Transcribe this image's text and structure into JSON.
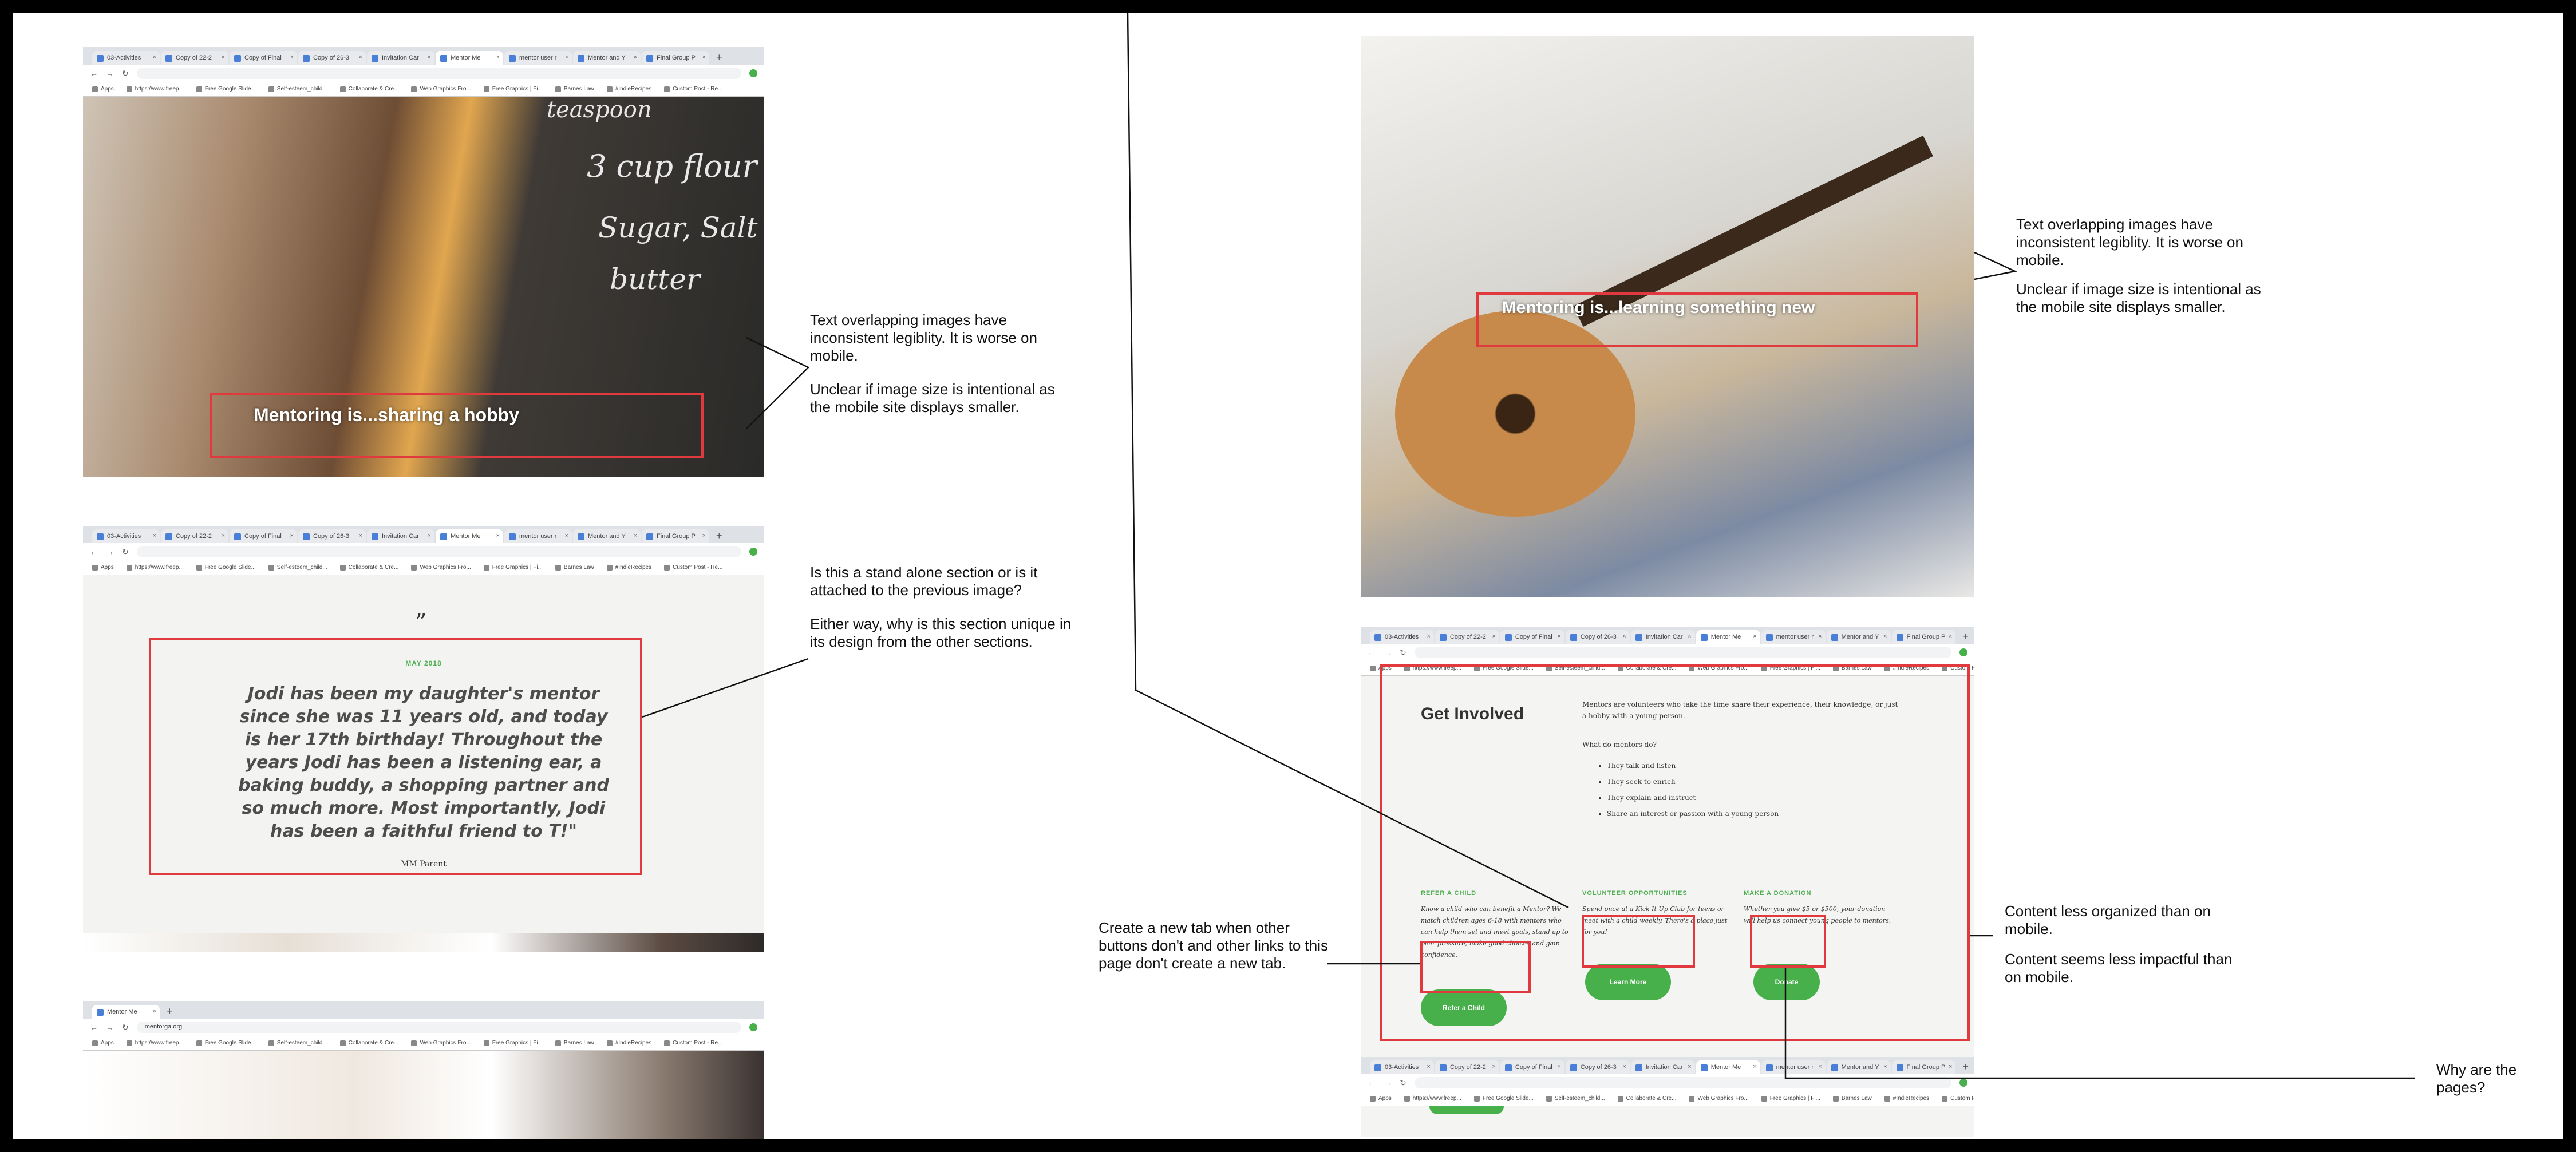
{
  "browser": {
    "tabs": [
      "03-Activities",
      "Copy of 22-2",
      "Copy of Final",
      "Copy of 26-3",
      "Invitation Car",
      "Mentor Me",
      "mentor user r",
      "Mentor and Y",
      "Final Group P"
    ],
    "new_tab_glyph": "+",
    "close_glyph": "×",
    "address": "mentorga.org",
    "bookmarks": [
      "Apps",
      "https://www.freep...",
      "Free Google Slide...",
      "Self-esteem_child...",
      "Collaborate & Cre...",
      "Web Graphics Fro...",
      "Free Graphics | Fi...",
      "Barnes Law",
      "#IndieRecipes",
      "Custom Post - Re..."
    ]
  },
  "mobile_tab": {
    "label": "Mentor Me"
  },
  "hero1": {
    "caption": "Mentoring is...sharing a hobby",
    "chalkboard": [
      "teaspoon",
      "3 cup flour",
      "Sugar, Salt",
      "butter"
    ]
  },
  "hero2": {
    "caption": "Mentoring is...learning something new"
  },
  "testimonial": {
    "mark": "”",
    "date": "MAY 2018",
    "quote": "Jodi has been my daughter's mentor since she was 11 years old, and today is her 17th birthday! Throughout the years Jodi has been a listening ear, a baking buddy, a shopping partner and so much more. Most importantly, Jodi has been a faithful friend to T!\"",
    "attribution": "MM Parent"
  },
  "get_involved": {
    "title": "Get Involved",
    "intro": "Mentors are volunteers who take the time share their experience, their knowledge, or just a hobby with a young person.",
    "question": "What do mentors do?",
    "list": [
      "They talk and listen",
      "They seek to enrich",
      "They explain and instruct",
      "Share an interest or passion with a young person"
    ],
    "columns": [
      {
        "heading": "REFER A CHILD",
        "text": "Know a child who can benefit a Mentor? We match children ages 6-18 with mentors who can help them set and meet goals, stand up to peer pressure, make good choices and gain confidence.",
        "button": "Refer a Child"
      },
      {
        "heading": "VOLUNTEER OPPORTUNITIES",
        "text": "Spend once at a Kick It Up Club for teens or meet with a child weekly. There's a place just for you!",
        "button": "Learn More"
      },
      {
        "heading": "MAKE A DONATION",
        "text": "Whether you give $5 or $500, your donation will help us connect young people to mentors.",
        "button": "Donate"
      }
    ]
  },
  "annotations": {
    "legibility_a": "Text overlapping images have inconsistent legiblity. It is worse on mobile.",
    "legibility_b": "Unclear if image size is intentional as the mobile site displays smaller.",
    "standalone_a": "Is this a stand alone section or is it attached to the previous image?",
    "standalone_b": "Either way, why is this section unique in its design from the other sections.",
    "legibility2_a": "Text overlapping images have inconsistent legiblity. It is worse on mobile.",
    "legibility2_b": "Unclear if image size is intentional as the mobile site displays smaller.",
    "new_tab": "Create a new tab when other buttons don't and other links to this page don't create a new tab.",
    "organized_a": "Content less organized than on mobile.",
    "organized_b": "Content seems less impactful than on mobile.",
    "pages": "Why are the pages?"
  },
  "colors": {
    "accent_green": "#47b04b",
    "highlight_red": "#e03a3e"
  }
}
